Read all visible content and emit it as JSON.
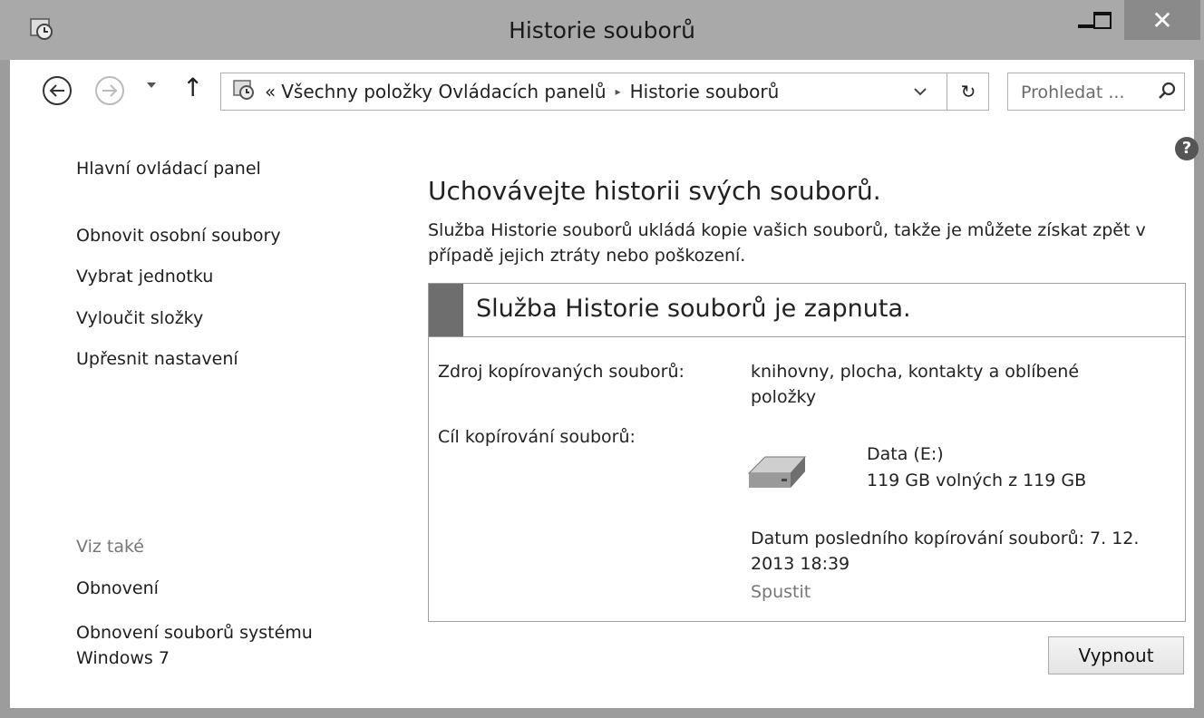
{
  "window": {
    "title": "Historie souborů",
    "close_glyph": "✕"
  },
  "nav": {
    "back_icon": "back-arrow-icon",
    "forward_icon": "forward-arrow-icon",
    "up_glyph": "↑",
    "breadcrumb": {
      "prefix": "«",
      "items": [
        "Všechny položky Ovládacích panelů",
        "Historie souborů"
      ],
      "separator": "▸"
    },
    "dropdown_glyph": "⌄",
    "refresh_glyph": "↻",
    "search_placeholder": "Prohledat ..."
  },
  "sidebar": {
    "home": "Hlavní ovládací panel",
    "items": [
      "Obnovit osobní soubory",
      "Vybrat jednotku",
      "Vyloučit složky",
      "Upřesnit nastavení"
    ],
    "see_also_header": "Viz také",
    "see_also": [
      "Obnovení",
      "Obnovení souborů systému Windows 7"
    ]
  },
  "main": {
    "heading": "Uchovávejte historii svých souborů.",
    "description": "Služba Historie souborů ukládá kopie vašich souborů, takže je můžete získat zpět v případě jejich ztráty nebo poškození.",
    "status_title": "Služba Historie souborů je zapnuta.",
    "source_label": "Zdroj kopírovaných souborů:",
    "source_value": "knihovny, plocha, kontakty a oblíbené položky",
    "target_label": "Cíl kopírování souborů:",
    "drive_name": "Data (E:)",
    "drive_space": "119 GB volných z 119 GB",
    "last_copy": "Datum posledního kopírování souborů: 7. 12. 2013 18:39",
    "run_link": "Spustit",
    "turn_off_button": "Vypnout"
  },
  "colors": {
    "titlebar": "#a9a9a9",
    "close_button": "#8a8a8a",
    "status_bar": "#6e6e6e"
  }
}
